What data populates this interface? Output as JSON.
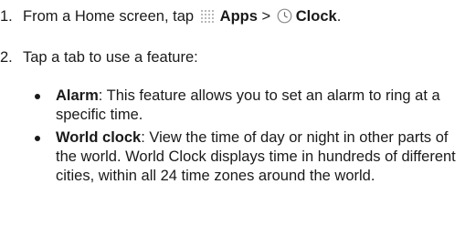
{
  "steps": [
    {
      "number": "1.",
      "text_before": "From a Home screen, tap",
      "apps_label": "Apps",
      "separator": ">",
      "clock_label": "Clock",
      "text_after": ".",
      "icons": [
        "apps-grid-icon",
        "clock-icon"
      ]
    },
    {
      "number": "2.",
      "text": "Tap a tab to use a feature:"
    }
  ],
  "bullets": [
    {
      "term": "Alarm",
      "description": ": This feature allows you to set an alarm to ring at a specific time."
    },
    {
      "term": "World clock",
      "description": ": View the time of day or night in other parts of the world. World Clock displays time in hundreds of different cities, within all 24 time zones around the world."
    }
  ]
}
